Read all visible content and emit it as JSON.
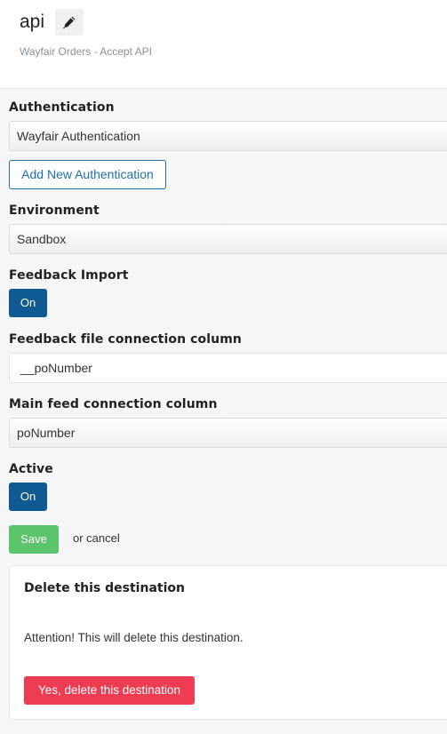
{
  "header": {
    "title": "api",
    "subtitle": "Wayfair Orders - Accept API"
  },
  "form": {
    "authentication": {
      "label": "Authentication",
      "value": "Wayfair Authentication",
      "add_button": "Add New Authentication"
    },
    "environment": {
      "label": "Environment",
      "value": "Sandbox"
    },
    "feedback_import": {
      "label": "Feedback Import",
      "toggle": "On"
    },
    "feedback_column": {
      "label": "Feedback file connection column",
      "value": "__poNumber"
    },
    "main_feed_column": {
      "label": "Main feed connection column",
      "value": "poNumber"
    },
    "active": {
      "label": "Active",
      "toggle": "On"
    },
    "save_label": "Save",
    "cancel_label": "or cancel"
  },
  "delete_panel": {
    "title": "Delete this destination",
    "warning": "Attention! This will delete this destination.",
    "button": "Yes, delete this destination"
  },
  "colors": {
    "primary": "#0f5a93",
    "link": "#1d6fb0",
    "success": "#5cc46a",
    "danger": "#ee3d52"
  }
}
